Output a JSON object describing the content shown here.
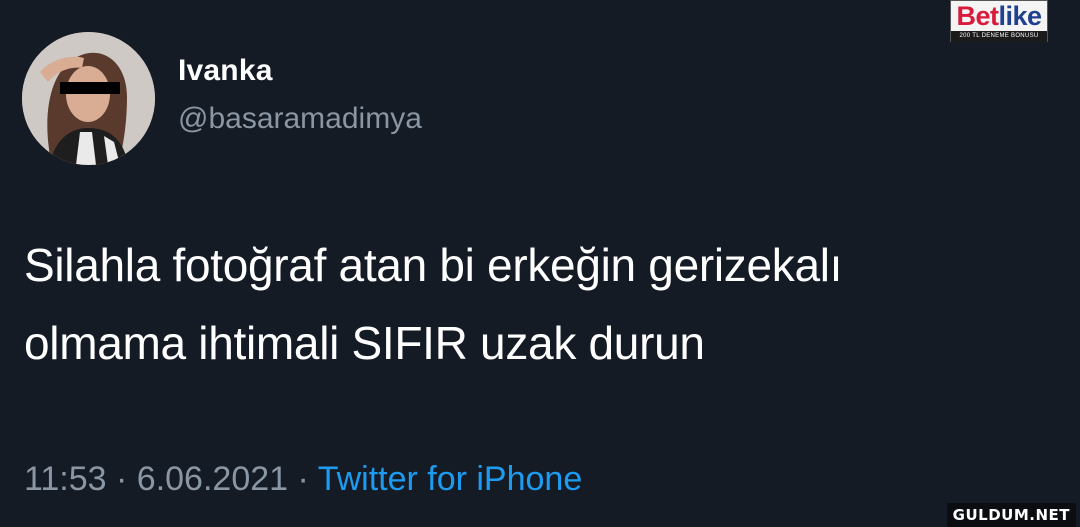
{
  "user": {
    "display_name": "Ivanka",
    "handle": "@basaramadimya"
  },
  "tweet": {
    "text_line_1": "Silahla fotoğraf atan bi erkeğin gerizekalı",
    "text_line_2": "olmama ihtimali SIFIR uzak durun",
    "time": "11:53",
    "separator": "·",
    "date": "6.06.2021",
    "source": "Twitter for iPhone"
  },
  "brand_logo": {
    "word_part_1": "Bet",
    "word_part_2": "like",
    "subtitle": "200 TL DENEME BONUSU"
  },
  "watermark": {
    "text": "GULDUM.NET"
  },
  "colors": {
    "background": "#151b25",
    "text_primary": "#ffffff",
    "text_secondary": "#8a96a3",
    "link": "#1d9bf0"
  }
}
